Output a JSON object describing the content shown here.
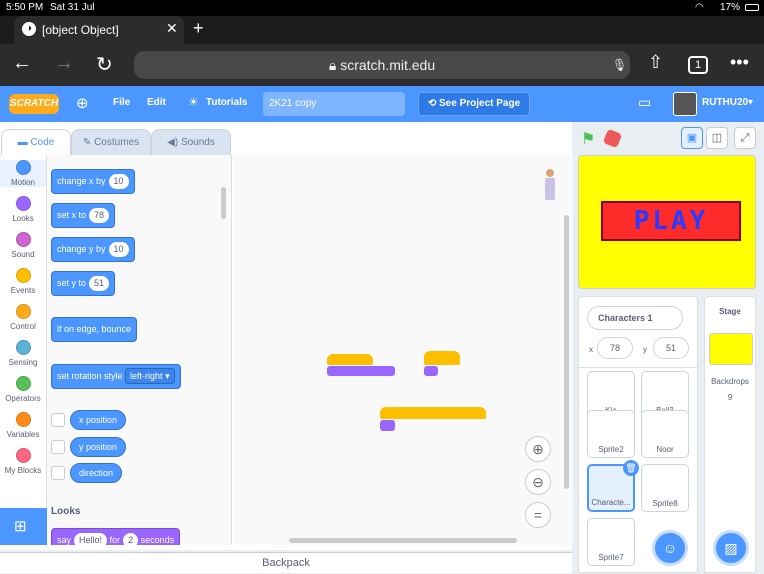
{
  "status_bar": {
    "time": "5:50 PM",
    "date": "Sat 31 Jul",
    "battery": "17%"
  },
  "browser": {
    "tab_title": "[object Object]",
    "url": "scratch.mit.edu",
    "tab_count": "1"
  },
  "menu": {
    "file": "File",
    "edit": "Edit",
    "tutorials": "Tutorials",
    "project_title": "2K21 copy",
    "see_project": "See Project Page",
    "username": "RUTHU20"
  },
  "editor_tabs": {
    "code": "Code",
    "costumes": "Costumes",
    "sounds": "Sounds"
  },
  "categories": [
    {
      "label": "Motion",
      "color": "#4c97ff"
    },
    {
      "label": "Looks",
      "color": "#9966ff"
    },
    {
      "label": "Sound",
      "color": "#cf63cf"
    },
    {
      "label": "Events",
      "color": "#ffbf00"
    },
    {
      "label": "Control",
      "color": "#ffab19"
    },
    {
      "label": "Sensing",
      "color": "#5cb1d6"
    },
    {
      "label": "Operators",
      "color": "#59c059"
    },
    {
      "label": "Variables",
      "color": "#ff8c1a"
    },
    {
      "label": "My Blocks",
      "color": "#ff6680"
    }
  ],
  "palette": {
    "change_x": {
      "label": "change x by",
      "value": "10"
    },
    "set_x": {
      "label": "set x to",
      "value": "78"
    },
    "change_y": {
      "label": "change y by",
      "value": "10"
    },
    "set_y": {
      "label": "set y to",
      "value": "51"
    },
    "bounce": "if on edge, bounce",
    "rotation": {
      "label": "set rotation style",
      "value": "left-right"
    },
    "x_position": "x position",
    "y_position": "y position",
    "direction": "direction",
    "looks_heading": "Looks",
    "say": {
      "label": "say",
      "message": "Hello!",
      "for": "for",
      "secs": "2",
      "unit": "seconds"
    }
  },
  "backpack": "Backpack",
  "stage_text": "PLAY",
  "sprite_info": {
    "name": "Characters 1",
    "x_label": "x",
    "x": "78",
    "y_label": "y",
    "y": "51"
  },
  "sprites": [
    "Kia",
    "Ball3",
    "Sprite2",
    "Noor",
    "Characte...",
    "Sprite8",
    "Sprite7"
  ],
  "stage_panel": {
    "title": "Stage",
    "backdrops_label": "Backdrops",
    "backdrops_count": "9"
  }
}
